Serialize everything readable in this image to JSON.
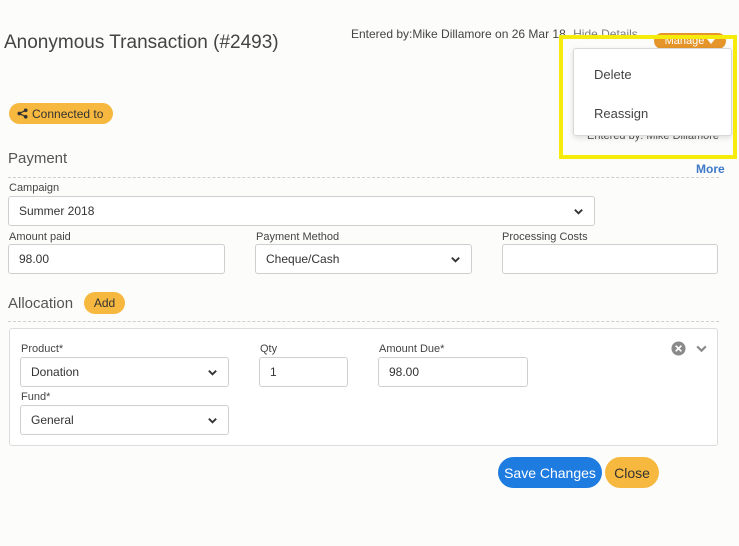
{
  "header": {
    "title": "Anonymous Transaction (#2493)",
    "entered_by": "Entered by:Mike Dillamore on 26 Mar 18",
    "hide_details": "Hide Details",
    "manage_label": "Manage"
  },
  "dropdown": {
    "items": [
      {
        "label": "Delete"
      },
      {
        "label": "Reassign"
      }
    ]
  },
  "connected": {
    "label": "Connected to"
  },
  "details": {
    "entered_by": "Entered by: Mike Dillamore"
  },
  "payment": {
    "section_title": "Payment",
    "more_label": "More",
    "campaign": {
      "label": "Campaign",
      "value": "Summer 2018"
    },
    "amount_paid": {
      "label": "Amount paid",
      "value": "98.00"
    },
    "payment_method": {
      "label": "Payment Method",
      "value": "Cheque/Cash"
    },
    "processing_costs": {
      "label": "Processing Costs",
      "value": ""
    }
  },
  "allocation": {
    "section_title": "Allocation",
    "add_label": "Add",
    "product": {
      "label": "Product*",
      "value": "Donation"
    },
    "qty": {
      "label": "Qty",
      "value": "1"
    },
    "amount_due": {
      "label": "Amount Due*",
      "value": "98.00"
    },
    "fund": {
      "label": "Fund*",
      "value": "General"
    }
  },
  "footer": {
    "save_label": "Save Changes",
    "close_label": "Close"
  },
  "colors": {
    "accent_orange": "#f6b83e",
    "manage_orange": "#e5952a",
    "primary_blue": "#1e7ce0",
    "link_blue": "#3d79c7",
    "highlight_yellow": "#f5ec0c"
  }
}
